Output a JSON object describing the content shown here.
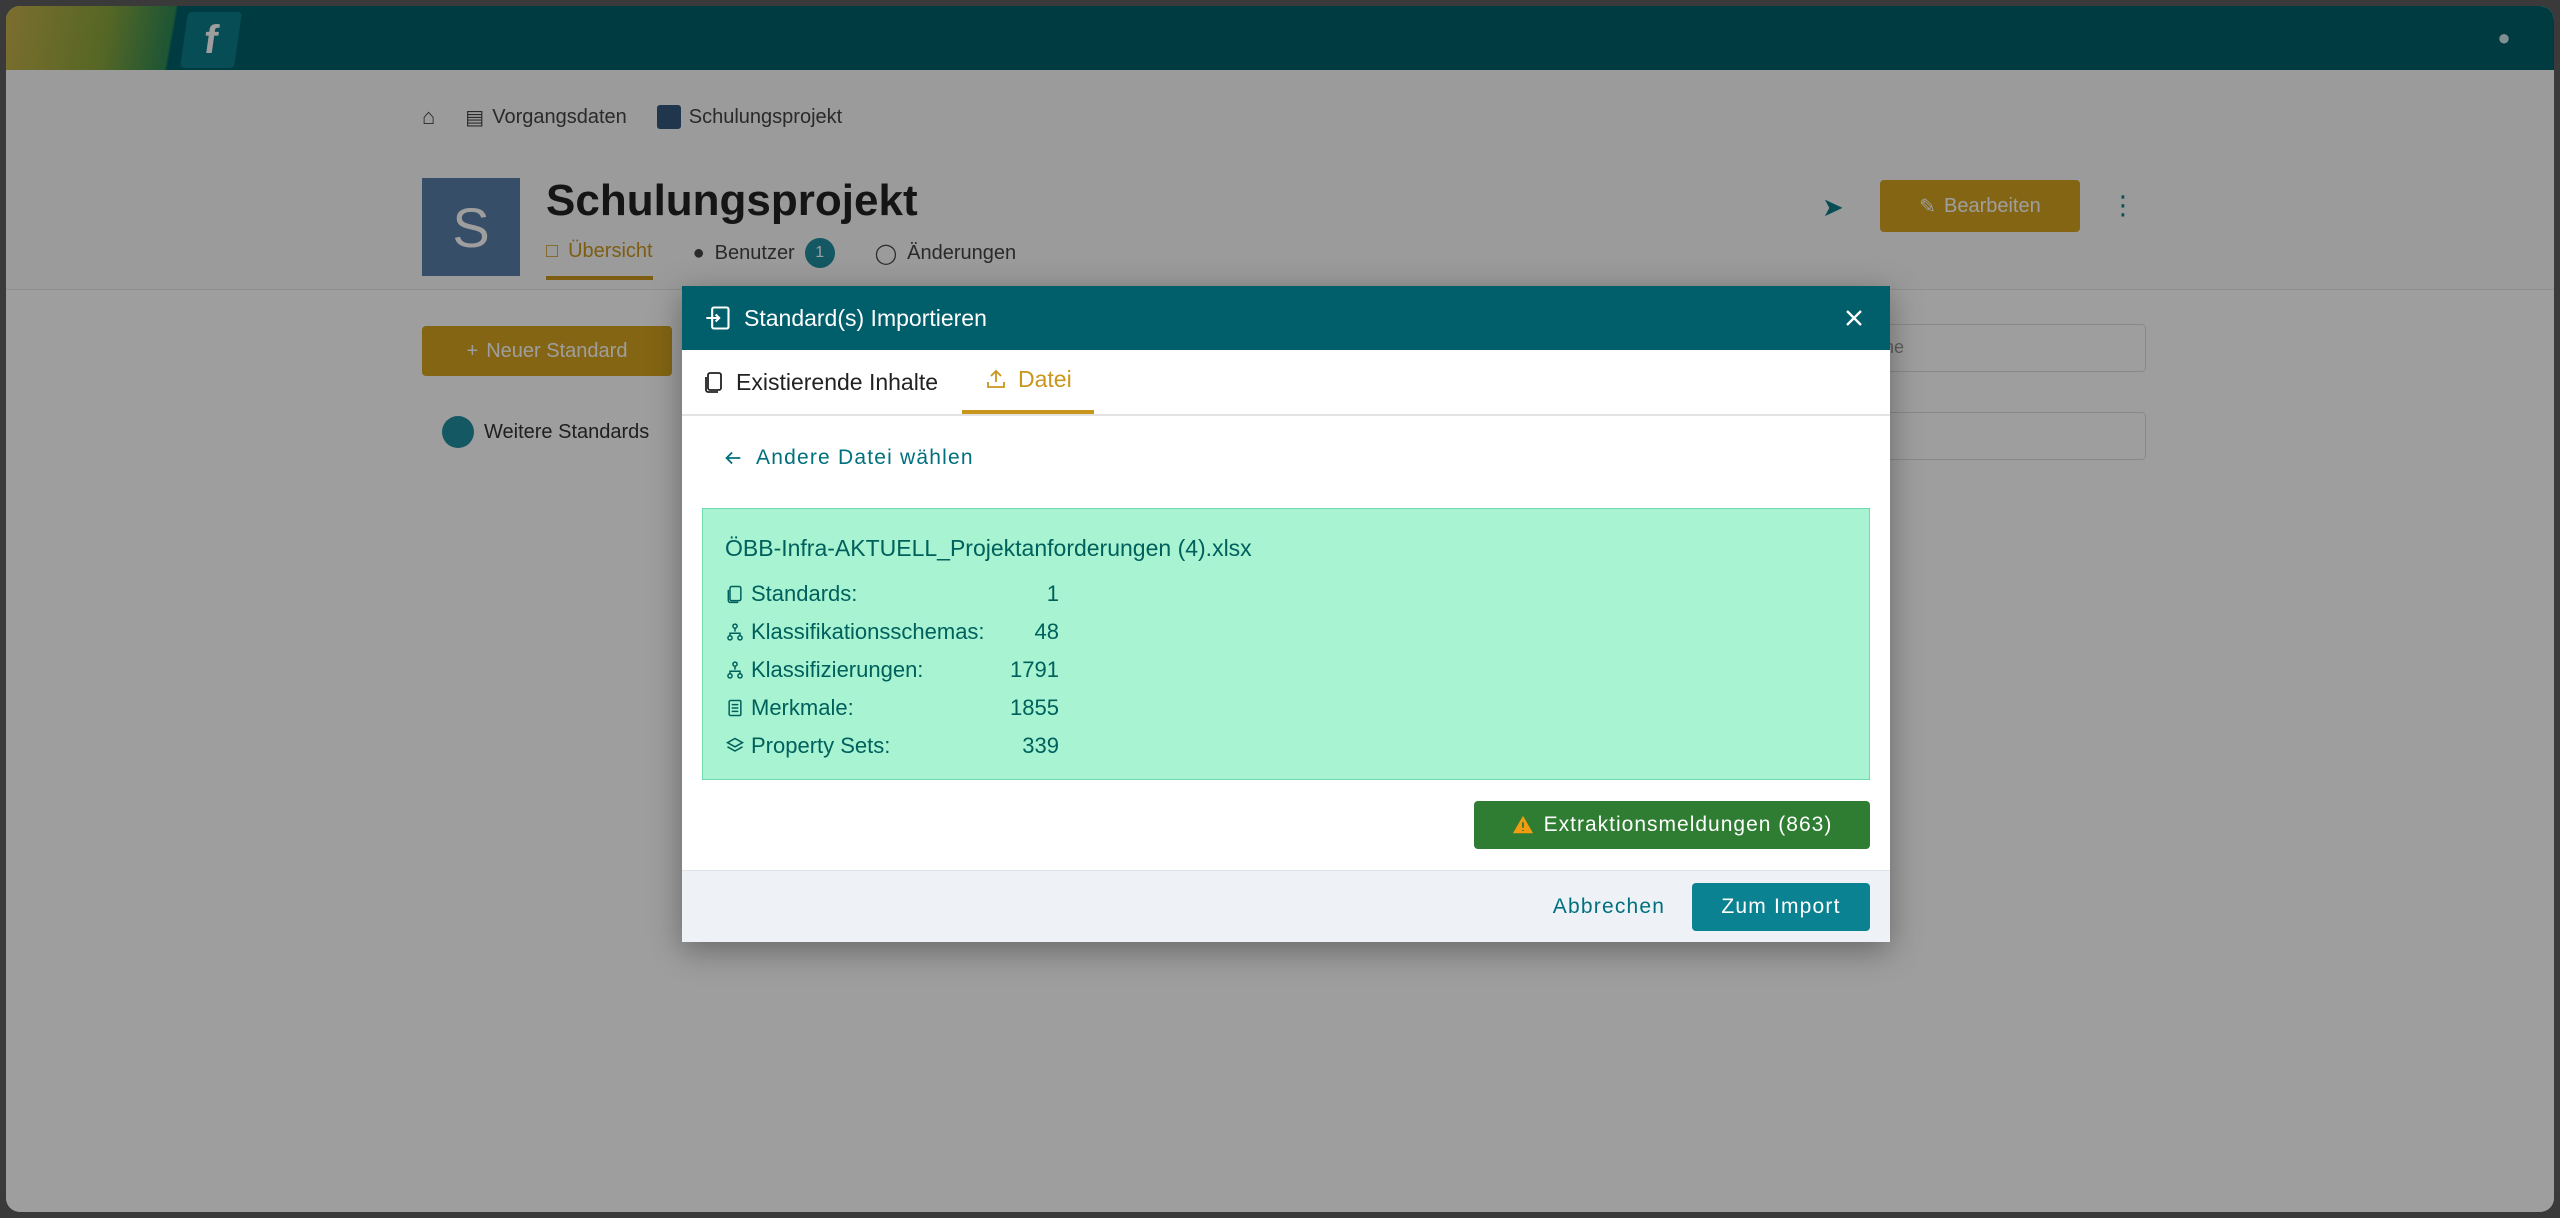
{
  "background": {
    "breadcrumb": [
      "Vorgangsdaten",
      "Schulungsprojekt"
    ],
    "project_initial": "S",
    "project_title": "Schulungsprojekt",
    "tabs": [
      {
        "label": "Übersicht",
        "icon": "clipboard-icon",
        "active": true
      },
      {
        "label": "Benutzer",
        "icon": "user-icon",
        "count": "1"
      },
      {
        "label": "Änderungen",
        "icon": "history-icon"
      }
    ],
    "edit_label": "Bearbeiten",
    "new_standard_label": "Neuer Standard",
    "more_standards_label": "Weitere Standards",
    "search_placeholder": "Suche"
  },
  "modal": {
    "title": "Standard(s) Importieren",
    "tabs": [
      {
        "label": "Existierende Inhalte",
        "icon": "copy-icon",
        "active": false
      },
      {
        "label": "Datei",
        "icon": "upload-icon",
        "active": true
      }
    ],
    "back_link": "Andere Datei wählen",
    "file": {
      "name": "ÖBB-Infra-AKTUELL_Projektanforderungen (4).xlsx",
      "stats": [
        {
          "icon": "copy-icon",
          "label": "Standards:",
          "value": "1"
        },
        {
          "icon": "hierarchy-icon",
          "label": "Klassifikationsschemas:",
          "value": "48"
        },
        {
          "icon": "hierarchy-icon",
          "label": "Klassifizierungen:",
          "value": "1791"
        },
        {
          "icon": "document-icon",
          "label": "Merkmale:",
          "value": "1855"
        },
        {
          "icon": "layers-icon",
          "label": "Property Sets:",
          "value": "339"
        }
      ]
    },
    "warning_button": "Extraktionsmeldungen (863)",
    "cancel_label": "Abbrechen",
    "import_label": "Zum Import"
  },
  "colors": {
    "header": "#005f6b",
    "accent": "#c9961c",
    "success_bg": "#a7f3d2",
    "success_text": "#00605c",
    "warning_button": "#2e7d32",
    "primary_button": "#0b8291"
  }
}
